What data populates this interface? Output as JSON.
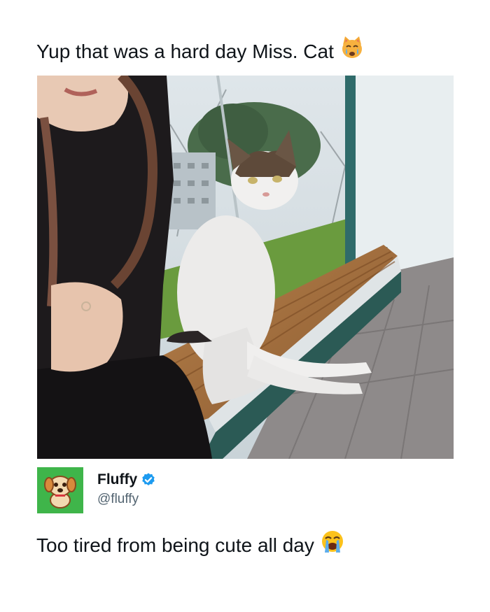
{
  "header": {
    "text": "Yup that was a hard day Miss. Cat"
  },
  "author": {
    "name": "Fluffy",
    "handle": "@fluffy"
  },
  "tweet": {
    "text": "Too tired from being cute all day"
  },
  "colors": {
    "avatar_bg": "#3fb54a",
    "verified": "#1d9bf0",
    "handle_text": "#536471"
  },
  "icons": {
    "header_emoji": "crying-cat-face",
    "tweet_emoji": "loudly-crying-face",
    "verified_badge": "verified-badge",
    "avatar_mascot": "puppy-mascot"
  }
}
